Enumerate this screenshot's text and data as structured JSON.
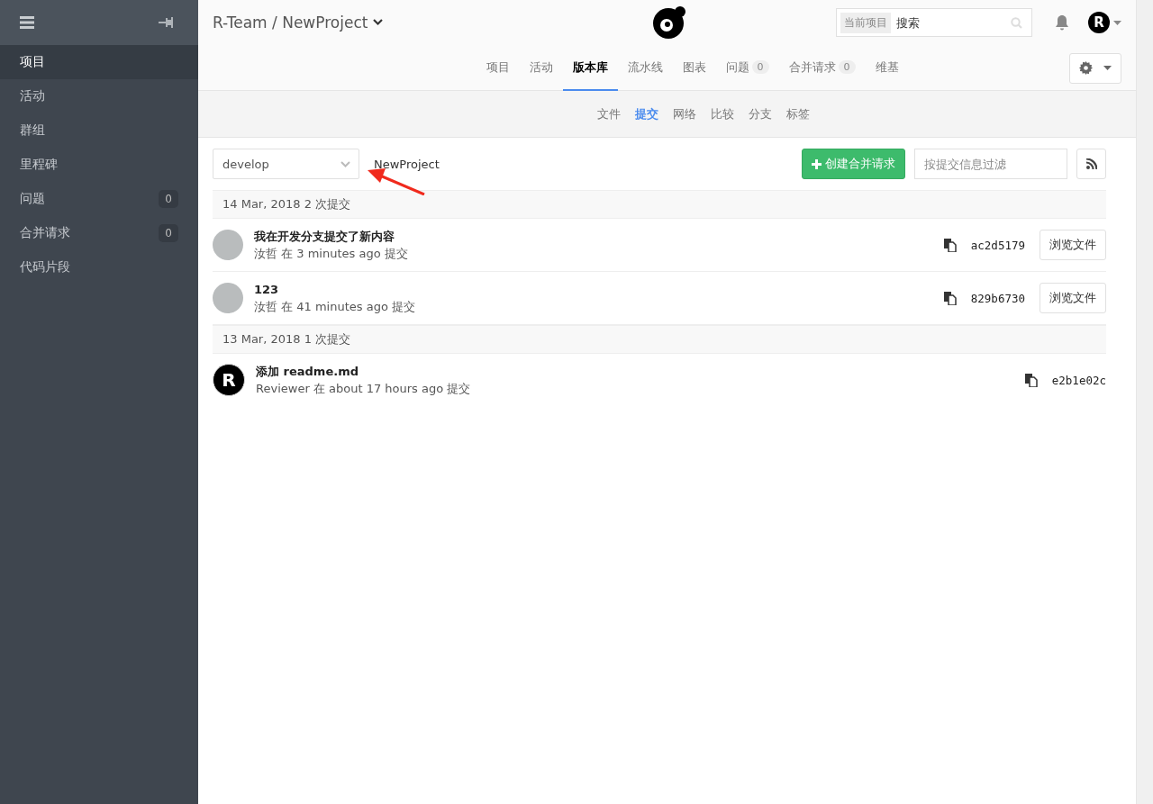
{
  "sidebar": {
    "items": [
      {
        "label": "项目",
        "selected": true
      },
      {
        "label": "活动",
        "selected": false
      },
      {
        "label": "群组",
        "selected": false
      },
      {
        "label": "里程碑",
        "selected": false
      },
      {
        "label": "问题",
        "count": "0",
        "selected": false
      },
      {
        "label": "合并请求",
        "count": "0",
        "selected": false
      },
      {
        "label": "代码片段",
        "selected": false
      }
    ]
  },
  "header": {
    "breadcrumb": "R-Team / NewProject",
    "search_scope": "当前项目",
    "search": {
      "placeholder": "搜索"
    },
    "user_avatar": "R"
  },
  "tabs": [
    {
      "label": "项目",
      "selected": false
    },
    {
      "label": "活动",
      "selected": false
    },
    {
      "label": "版本库",
      "selected": true
    },
    {
      "label": "流水线",
      "selected": false
    },
    {
      "label": "图表",
      "selected": false
    },
    {
      "label": "问题",
      "count": "0",
      "selected": false
    },
    {
      "label": "合并请求",
      "count": "0",
      "selected": false
    },
    {
      "label": "维基",
      "selected": false
    }
  ],
  "subtabs": [
    {
      "label": "文件",
      "selected": false
    },
    {
      "label": "提交",
      "selected": true
    },
    {
      "label": "网络",
      "selected": false
    },
    {
      "label": "比较",
      "selected": false
    },
    {
      "label": "分支",
      "selected": false
    },
    {
      "label": "标签",
      "selected": false
    }
  ],
  "toolbar": {
    "branch": "develop",
    "project": "NewProject",
    "create_button": "创建合并请求",
    "filter": {
      "placeholder": "按提交信息过滤"
    }
  },
  "groups": [
    {
      "header": "14 Mar, 2018 2 次提交",
      "commits": [
        {
          "avatar": {
            "kind": "photo"
          },
          "title": "我在开发分支提交了新内容",
          "meta": "汝哲 在 3 minutes ago 提交",
          "sha": "ac2d5179",
          "browse": "浏览文件"
        },
        {
          "avatar": {
            "kind": "photo"
          },
          "title": "123",
          "meta": "汝哲 在 41 minutes ago 提交",
          "sha": "829b6730",
          "browse": "浏览文件"
        }
      ]
    },
    {
      "header": "13 Mar, 2018 1 次提交",
      "commits": [
        {
          "avatar": {
            "kind": "letter",
            "letter": "R"
          },
          "title": "添加 readme.md",
          "meta": "Reviewer 在 about 17 hours ago 提交",
          "sha": "e2b1e02c"
        }
      ]
    }
  ]
}
